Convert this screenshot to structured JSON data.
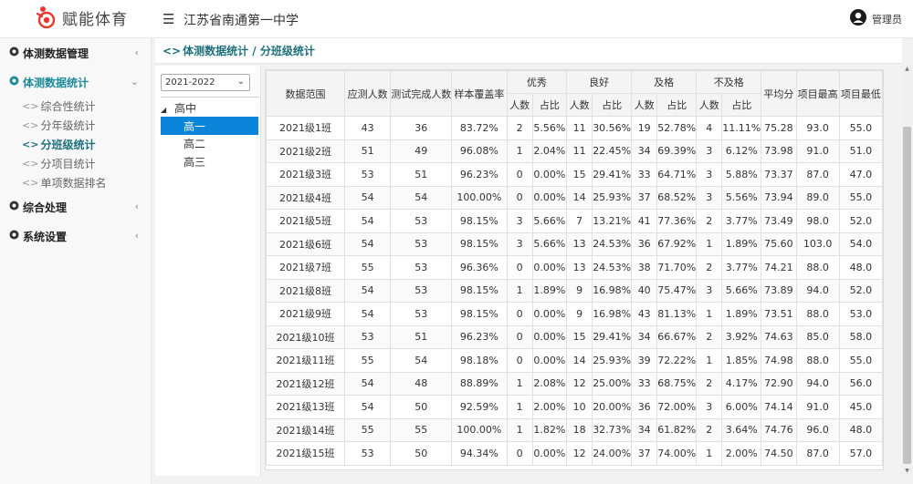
{
  "header": {
    "app_name": "赋能体育",
    "school": "江苏省南通第一中学",
    "user": "管理员"
  },
  "sidebar": {
    "groups": [
      {
        "label": "体测数据管理",
        "expanded": false
      },
      {
        "label": "体测数据统计",
        "expanded": true,
        "items": [
          "综合性统计",
          "分年级统计",
          "分班级统计",
          "分项目统计",
          "单项数据排名"
        ],
        "active_item": "分班级统计"
      },
      {
        "label": "综合处理",
        "expanded": false
      },
      {
        "label": "系统设置",
        "expanded": false
      }
    ]
  },
  "breadcrumb": "体测数据统计 / 分班级统计",
  "tree": {
    "year": "2021-2022",
    "root": "高中",
    "nodes": [
      "高一",
      "高二",
      "高三"
    ],
    "selected": "高一"
  },
  "table": {
    "headers": {
      "range": "数据范围",
      "expected": "应测人数",
      "completed": "测试完成人数",
      "coverage": "样本覆盖率",
      "excellent": "优秀",
      "good": "良好",
      "pass": "及格",
      "fail": "不及格",
      "count": "人数",
      "ratio": "占比",
      "avg": "平均分",
      "max": "项目最高",
      "min": "项目最低"
    },
    "rows": [
      [
        "2021级1班",
        "43",
        "36",
        "83.72%",
        "2",
        "5.56%",
        "11",
        "30.56%",
        "19",
        "52.78%",
        "4",
        "11.11%",
        "75.28",
        "93.0",
        "55.0"
      ],
      [
        "2021级2班",
        "51",
        "49",
        "96.08%",
        "1",
        "2.04%",
        "11",
        "22.45%",
        "34",
        "69.39%",
        "3",
        "6.12%",
        "73.98",
        "91.0",
        "51.0"
      ],
      [
        "2021级3班",
        "53",
        "51",
        "96.23%",
        "0",
        "0.00%",
        "15",
        "29.41%",
        "33",
        "64.71%",
        "3",
        "5.88%",
        "73.37",
        "87.0",
        "47.0"
      ],
      [
        "2021级4班",
        "54",
        "54",
        "100.00%",
        "0",
        "0.00%",
        "14",
        "25.93%",
        "37",
        "68.52%",
        "3",
        "5.56%",
        "73.94",
        "89.0",
        "55.0"
      ],
      [
        "2021级5班",
        "54",
        "53",
        "98.15%",
        "3",
        "5.66%",
        "7",
        "13.21%",
        "41",
        "77.36%",
        "2",
        "3.77%",
        "73.49",
        "98.0",
        "52.0"
      ],
      [
        "2021级6班",
        "54",
        "53",
        "98.15%",
        "3",
        "5.66%",
        "13",
        "24.53%",
        "36",
        "67.92%",
        "1",
        "1.89%",
        "75.60",
        "103.0",
        "54.0"
      ],
      [
        "2021级7班",
        "55",
        "53",
        "96.36%",
        "0",
        "0.00%",
        "13",
        "24.53%",
        "38",
        "71.70%",
        "2",
        "3.77%",
        "74.21",
        "88.0",
        "48.0"
      ],
      [
        "2021级8班",
        "54",
        "53",
        "98.15%",
        "1",
        "1.89%",
        "9",
        "16.98%",
        "40",
        "75.47%",
        "3",
        "5.66%",
        "73.89",
        "94.0",
        "52.0"
      ],
      [
        "2021级9班",
        "54",
        "53",
        "98.15%",
        "0",
        "0.00%",
        "9",
        "16.98%",
        "43",
        "81.13%",
        "1",
        "1.89%",
        "73.51",
        "88.0",
        "53.0"
      ],
      [
        "2021级10班",
        "53",
        "51",
        "96.23%",
        "0",
        "0.00%",
        "15",
        "29.41%",
        "34",
        "66.67%",
        "2",
        "3.92%",
        "74.63",
        "85.0",
        "58.0"
      ],
      [
        "2021级11班",
        "55",
        "54",
        "98.18%",
        "0",
        "0.00%",
        "14",
        "25.93%",
        "39",
        "72.22%",
        "1",
        "1.85%",
        "74.98",
        "88.0",
        "55.0"
      ],
      [
        "2021级12班",
        "54",
        "48",
        "88.89%",
        "1",
        "2.08%",
        "12",
        "25.00%",
        "33",
        "68.75%",
        "2",
        "4.17%",
        "72.90",
        "94.0",
        "56.0"
      ],
      [
        "2021级13班",
        "54",
        "50",
        "92.59%",
        "1",
        "2.00%",
        "10",
        "20.00%",
        "36",
        "72.00%",
        "3",
        "6.00%",
        "74.14",
        "91.0",
        "45.0"
      ],
      [
        "2021级14班",
        "55",
        "55",
        "100.00%",
        "1",
        "1.82%",
        "18",
        "32.73%",
        "34",
        "61.82%",
        "2",
        "3.64%",
        "74.76",
        "96.0",
        "48.0"
      ],
      [
        "2021级15班",
        "53",
        "50",
        "94.34%",
        "0",
        "0.00%",
        "12",
        "24.00%",
        "37",
        "74.00%",
        "1",
        "2.00%",
        "74.50",
        "87.0",
        "57.0"
      ]
    ]
  },
  "colors": {
    "accent": "#1e8a99",
    "selected_node": "#0a85d9",
    "logo_red": "#e8372f"
  }
}
